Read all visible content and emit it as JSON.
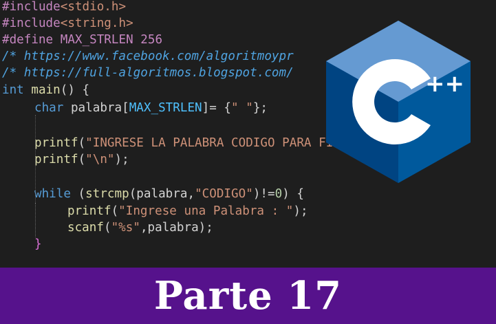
{
  "code": {
    "line1_pp": "#include",
    "line1_arg": "<stdio.h>",
    "line2_pp": "#include",
    "line2_arg": "<string.h>",
    "line3": "#define MAX_STRLEN 256",
    "line4": "/* https://www.facebook.com/algoritmoypr",
    "line5": "/* https://full-algoritmos.blogspot.com/",
    "line6_kw": "int",
    "line6_fn": "main",
    "line6_rest": "() {",
    "line7_kw": "char",
    "line7_var": "palabra[",
    "line7_macro": "MAX_STRLEN",
    "line7_mid": "]= {",
    "line7_str": "\" \"",
    "line7_end": "};",
    "line9_fn": "printf",
    "line9_open": "(",
    "line9_str": "\"INGRESE LA PALABRA CODIGO PARA FINALIZAR\\n\"",
    "line9_end": ");",
    "line10_fn": "printf",
    "line10_open": "(",
    "line10_str": "\"\\n\"",
    "line10_end": ");",
    "line12_kw": "while",
    "line12_a": " (",
    "line12_fn": "strcmp",
    "line12_b": "(palabra,",
    "line12_str": "\"CODIGO\"",
    "line12_c": ")!=",
    "line12_num": "0",
    "line12_d": ") {",
    "line13_fn": "printf",
    "line13_open": "(",
    "line13_str": "\"Ingrese una Palabra : \"",
    "line13_end": ");",
    "line14_fn": "scanf",
    "line14_open": "(",
    "line14_str": "\"%s\"",
    "line14_end": ",palabra);",
    "line15": "}"
  },
  "logo": {
    "letter": "C",
    "plus": "++",
    "colors": [
      "#659ad2",
      "#004482",
      "#00599c",
      "#ffffff"
    ]
  },
  "banner": {
    "title": "Parte 17",
    "background": "#56128c"
  }
}
